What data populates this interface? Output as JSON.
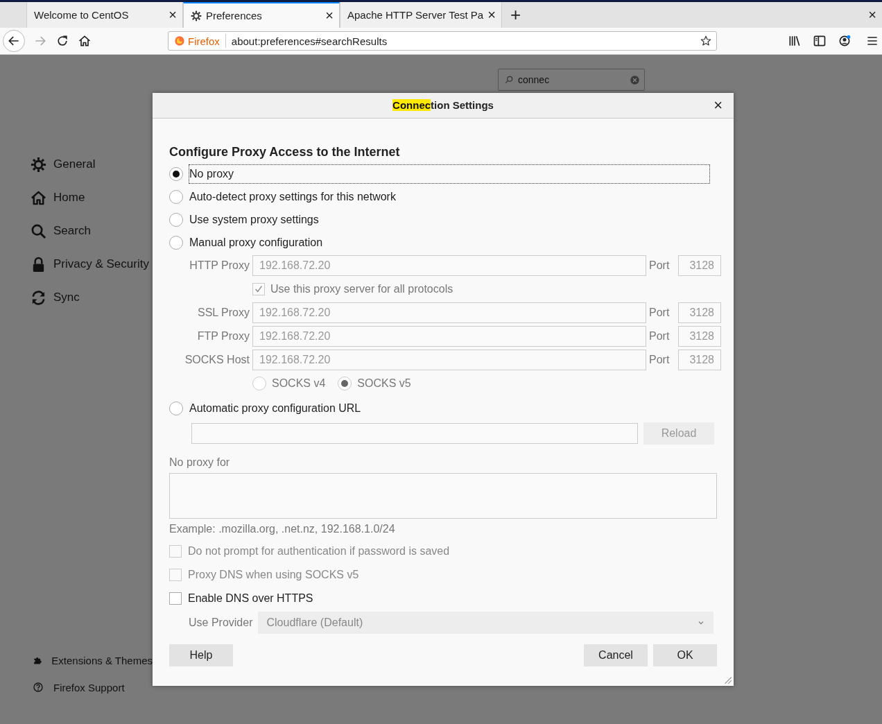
{
  "tabs": [
    {
      "title": "Welcome to CentOS",
      "selected": false,
      "kind": "page",
      "close": "×"
    },
    {
      "title": "Preferences",
      "selected": true,
      "kind": "settings",
      "close": "×"
    },
    {
      "title": "Apache HTTP Server Test Pa",
      "selected": false,
      "kind": "page",
      "close": "×"
    }
  ],
  "new_tab": "+",
  "window_close": "×",
  "toolbar": {
    "identity": "Firefox",
    "url": "about:preferences#searchResults"
  },
  "sidebar": {
    "items": [
      {
        "label": "General",
        "kind": "general"
      },
      {
        "label": "Home",
        "kind": "home"
      },
      {
        "label": "Search",
        "kind": "search"
      },
      {
        "label": "Privacy & Security",
        "kind": "privacy"
      },
      {
        "label": "Sync",
        "kind": "sync"
      }
    ],
    "footer": [
      {
        "label": "Extensions & Themes",
        "kind": "addons"
      },
      {
        "label": "Firefox Support",
        "kind": "support"
      }
    ]
  },
  "search": {
    "value": "connec"
  },
  "dialog": {
    "title": {
      "highlighted": "Connec",
      "rest": "tion Settings"
    },
    "close": "×",
    "heading": "Configure Proxy Access to the Internet",
    "proxy_options": [
      {
        "label": "No proxy",
        "selected": true,
        "focused": true
      },
      {
        "label": "Auto-detect proxy settings for this network",
        "selected": false,
        "focused": false
      },
      {
        "label": "Use system proxy settings",
        "selected": false,
        "focused": false
      },
      {
        "label": "Manual proxy configuration",
        "selected": false,
        "focused": false
      }
    ],
    "manual": {
      "disabled": true,
      "http": {
        "label": "HTTP Proxy",
        "value": "192.168.72.20",
        "port_label": "Port",
        "port": "3128"
      },
      "share": {
        "label": "Use this proxy server for all protocols",
        "checked": true
      },
      "rows": [
        {
          "label": "SSL Proxy",
          "value": "192.168.72.20",
          "port_label": "Port",
          "port": "3128"
        },
        {
          "label": "FTP Proxy",
          "value": "192.168.72.20",
          "port_label": "Port",
          "port": "3128"
        },
        {
          "label": "SOCKS Host",
          "value": "192.168.72.20",
          "port_label": "Port",
          "port": "3128"
        }
      ],
      "socks_versions": [
        {
          "label": "SOCKS v4",
          "selected": false
        },
        {
          "label": "SOCKS v5",
          "selected": true
        }
      ]
    },
    "auto_config": {
      "label": "Automatic proxy configuration URL",
      "selected": false,
      "reload": "Reload"
    },
    "no_proxy_label": "No proxy for",
    "example": "Example: .mozilla.org, .net.nz, 192.168.1.0/24",
    "checkboxes": [
      {
        "label": "Do not prompt for authentication if password is saved",
        "checked": false,
        "disabled": true
      },
      {
        "label": "Proxy DNS when using SOCKS v5",
        "checked": false,
        "disabled": true
      },
      {
        "label": "Enable DNS over HTTPS",
        "checked": false,
        "disabled": false
      }
    ],
    "provider": {
      "label": "Use Provider",
      "value": "Cloudflare (Default)",
      "disabled": true
    },
    "buttons": {
      "help": "Help",
      "cancel": "Cancel",
      "ok": "OK"
    }
  }
}
